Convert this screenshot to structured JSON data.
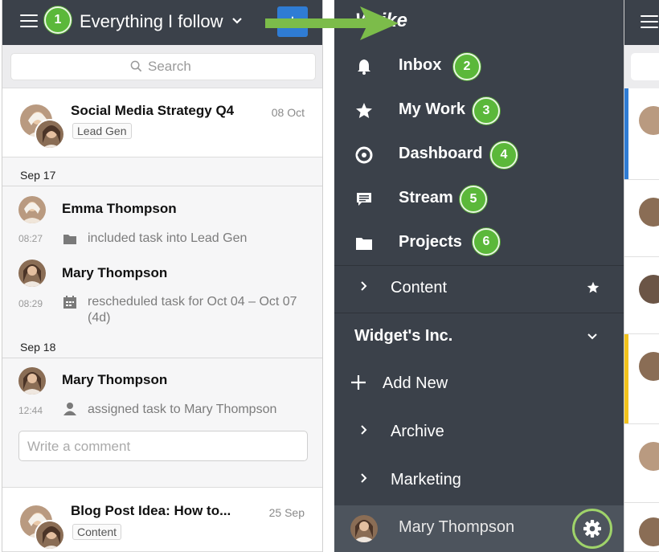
{
  "left_panel": {
    "header": {
      "title": "Everything I follow",
      "plus_label": "+"
    },
    "search": {
      "placeholder": "Search"
    },
    "tasks": [
      {
        "title": "Social Media Strategy Q4",
        "date": "08 Oct",
        "tag": "Lead Gen"
      },
      {
        "title": "Blog Post Idea: How to...",
        "date": "25 Sep",
        "tag": "Content"
      }
    ],
    "feed": {
      "groups": [
        {
          "date": "Sep 17"
        },
        {
          "date": "Sep 18"
        }
      ],
      "entries": [
        {
          "name": "Emma Thompson",
          "time": "08:27",
          "icon": "folder-icon",
          "text": "included task into Lead Gen"
        },
        {
          "name": "Mary Thompson",
          "time": "08:29",
          "icon": "calendar-icon",
          "text": "rescheduled task for Oct 04 – Oct 07 (4d)"
        },
        {
          "name": "Mary Thompson",
          "time": "12:44",
          "icon": "person-icon",
          "text": "assigned task to Mary Thompson"
        }
      ],
      "comment_placeholder": "Write a comment"
    }
  },
  "nav_panel": {
    "brand": "Wrike",
    "items": [
      {
        "label": "Inbox",
        "icon": "bell-icon",
        "badge": "2"
      },
      {
        "label": "My Work",
        "icon": "star-icon",
        "badge": "3"
      },
      {
        "label": "Dashboard",
        "icon": "dashboard-icon",
        "badge": "4"
      },
      {
        "label": "Stream",
        "icon": "chat-icon",
        "badge": "5"
      },
      {
        "label": "Projects",
        "icon": "folder-icon",
        "badge": "6"
      }
    ],
    "content_row": {
      "label": "Content"
    },
    "workspace": {
      "label": "Widget's Inc."
    },
    "add_new": {
      "label": "Add New"
    },
    "folders": [
      {
        "label": "Archive"
      },
      {
        "label": "Marketing"
      }
    ],
    "account": {
      "name": "Mary Thompson"
    }
  },
  "callouts": {
    "header_badge": "1"
  },
  "colors": {
    "header_bg": "#3b414a",
    "accent_blue": "#2f7cd4",
    "badge_green": "#5bb83a",
    "accent_yellow": "#f2c21b"
  }
}
